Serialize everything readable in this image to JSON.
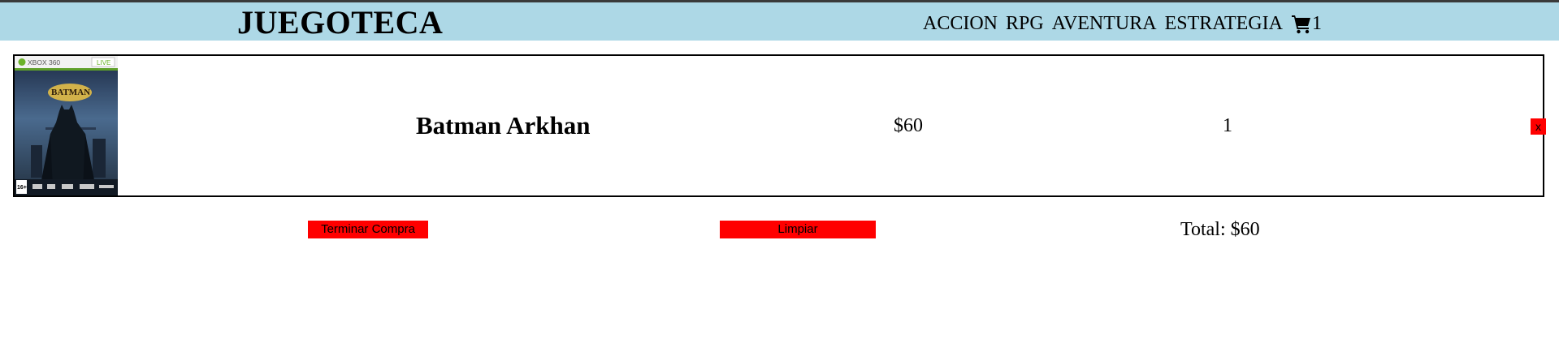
{
  "navbar": {
    "brand": "JUEGOTECA",
    "links": [
      "ACCION",
      "RPG",
      "AVENTURA",
      "ESTRATEGIA"
    ],
    "cart_icon": "shopping-cart-icon",
    "cart_count": "1",
    "background_color": "#add8e6"
  },
  "cart": {
    "items": [
      {
        "cover": {
          "platform_label": "XBOX 360",
          "live_label": "LIVE",
          "title_art": "BATMAN",
          "rating": "16+"
        },
        "name": "Batman Arkhan",
        "price": "$60",
        "quantity": "1",
        "remove_label": "x"
      }
    ]
  },
  "actions": {
    "finish_label": "Terminar Compra",
    "clear_label": "Limpiar",
    "button_color": "#ff0000"
  },
  "summary": {
    "total_text": "Total: $60"
  }
}
